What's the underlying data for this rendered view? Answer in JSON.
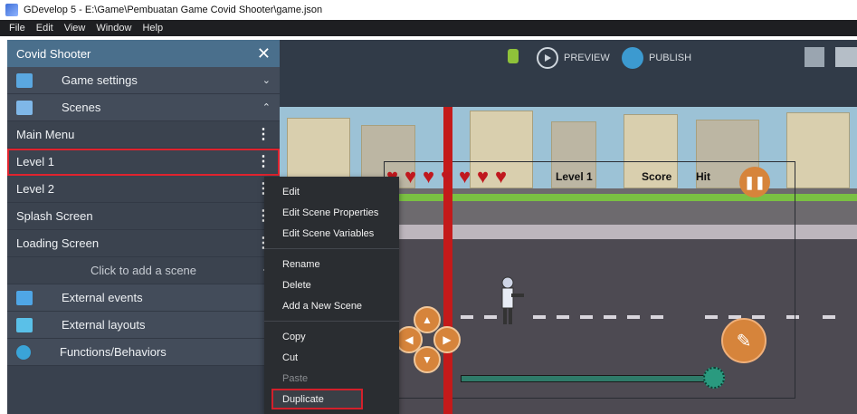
{
  "window": {
    "title": "GDevelop 5 - E:\\Game\\Pembuatan Game Covid Shooter\\game.json"
  },
  "menubar": [
    "File",
    "Edit",
    "View",
    "Window",
    "Help"
  ],
  "project": {
    "name": "Covid Shooter",
    "close_glyph": "✕",
    "sections": {
      "game_settings": {
        "label": "Game settings",
        "chevron": "⌄"
      },
      "scenes": {
        "label": "Scenes",
        "chevron": "⌃"
      },
      "external_events": {
        "label": "External events",
        "chevron": "⌄"
      },
      "external_layouts": {
        "label": "External layouts",
        "chevron": "⌄"
      },
      "functions": {
        "label": "Functions/Behaviors",
        "chevron": "⌄"
      }
    },
    "scenes": [
      {
        "label": "Main Menu"
      },
      {
        "label": "Level 1",
        "selected": true
      },
      {
        "label": "Level 2"
      },
      {
        "label": "Splash Screen"
      },
      {
        "label": "Loading Screen"
      }
    ],
    "add_scene": "Click to add a scene",
    "kebab_glyph": "⋮",
    "plus_glyph": "+"
  },
  "toolbar": {
    "preview": "PREVIEW",
    "publish": "PUBLISH"
  },
  "game": {
    "level_text": "Level 1",
    "score_text": "Score",
    "hit_text": "Hit",
    "hearts": 7
  },
  "context_menu": {
    "items": [
      {
        "label": "Edit"
      },
      {
        "label": "Edit Scene Properties"
      },
      {
        "label": "Edit Scene Variables"
      },
      {
        "label": "Rename"
      },
      {
        "label": "Delete"
      },
      {
        "label": "Add a New Scene"
      },
      {
        "label": "Copy"
      },
      {
        "label": "Cut"
      },
      {
        "label": "Paste",
        "disabled": true
      },
      {
        "label": "Duplicate",
        "highlighted": true
      }
    ]
  },
  "colors": {
    "accent_red": "#e0232e",
    "panel": "#39414e",
    "header": "#4a6f8c",
    "menu": "#2a2d31"
  }
}
